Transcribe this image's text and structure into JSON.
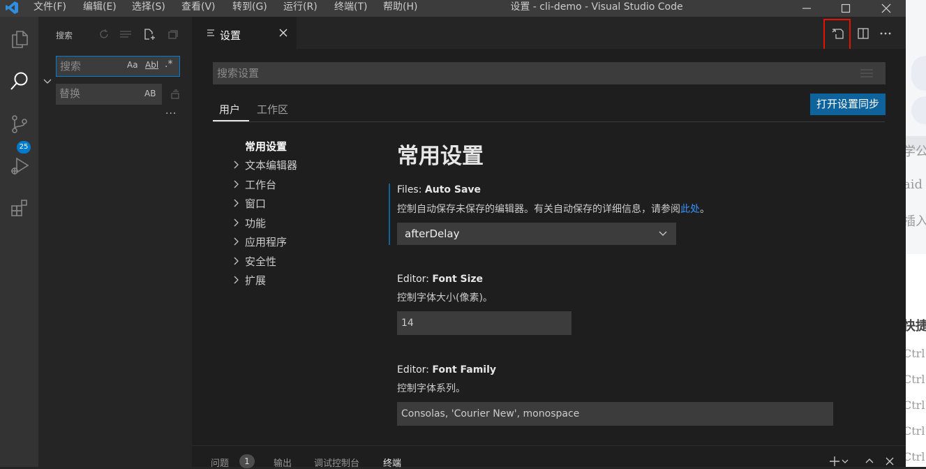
{
  "titlebar": {
    "menus": [
      "文件(F)",
      "编辑(E)",
      "选择(S)",
      "查看(V)",
      "转到(G)",
      "运行(R)",
      "终端(T)",
      "帮助(H)"
    ],
    "title": "设置 - cli-demo - Visual Studio Code"
  },
  "activitybar": {
    "items": [
      "files-icon",
      "search-icon",
      "source-control-icon",
      "run-debug-icon",
      "extensions-icon"
    ],
    "scm_badge": "25"
  },
  "sidebar": {
    "title": "搜索",
    "search_placeholder": "搜索",
    "match_case": "Aa",
    "whole_word": "Abl",
    "regex": ".*",
    "replace_placeholder": "替换",
    "preserve_case": "AB",
    "more": "..."
  },
  "editor": {
    "tab_label": "设置",
    "search_placeholder": "搜索设置",
    "scope_tabs": [
      "用户",
      "工作区"
    ],
    "sync_button": "打开设置同步",
    "toc": [
      "常用设置",
      "文本编辑器",
      "工作台",
      "窗口",
      "功能",
      "应用程序",
      "安全性",
      "扩展"
    ],
    "section_title": "常用设置",
    "settings": {
      "autosave": {
        "category": "Files: ",
        "name": "Auto Save",
        "desc": "控制自动保存未保存的编辑器。有关自动保存的详细信息，请参阅",
        "link": "此处",
        "desc_end": "。",
        "value": "afterDelay"
      },
      "fontsize": {
        "category": "Editor: ",
        "name": "Font Size",
        "desc": "控制字体大小(像素)。",
        "value": "14"
      },
      "fontfamily": {
        "category": "Editor: ",
        "name": "Font Family",
        "desc": "控制字体系列。",
        "value": "Consolas, 'Courier New', monospace"
      }
    }
  },
  "panel": {
    "tabs": [
      "问题",
      "输出",
      "调试控制台",
      "终端"
    ],
    "problems_count": "1",
    "active": "终端"
  },
  "background_window": {
    "texts": [
      "学公",
      "aid",
      "插入",
      "快捷",
      "Ctrl",
      "Ctrl",
      "Ctrl",
      "Ctrl",
      "Ctrl"
    ]
  },
  "colors": {
    "accent": "#007acc",
    "button": "#0e639c",
    "highlight_box": "#e51400"
  }
}
